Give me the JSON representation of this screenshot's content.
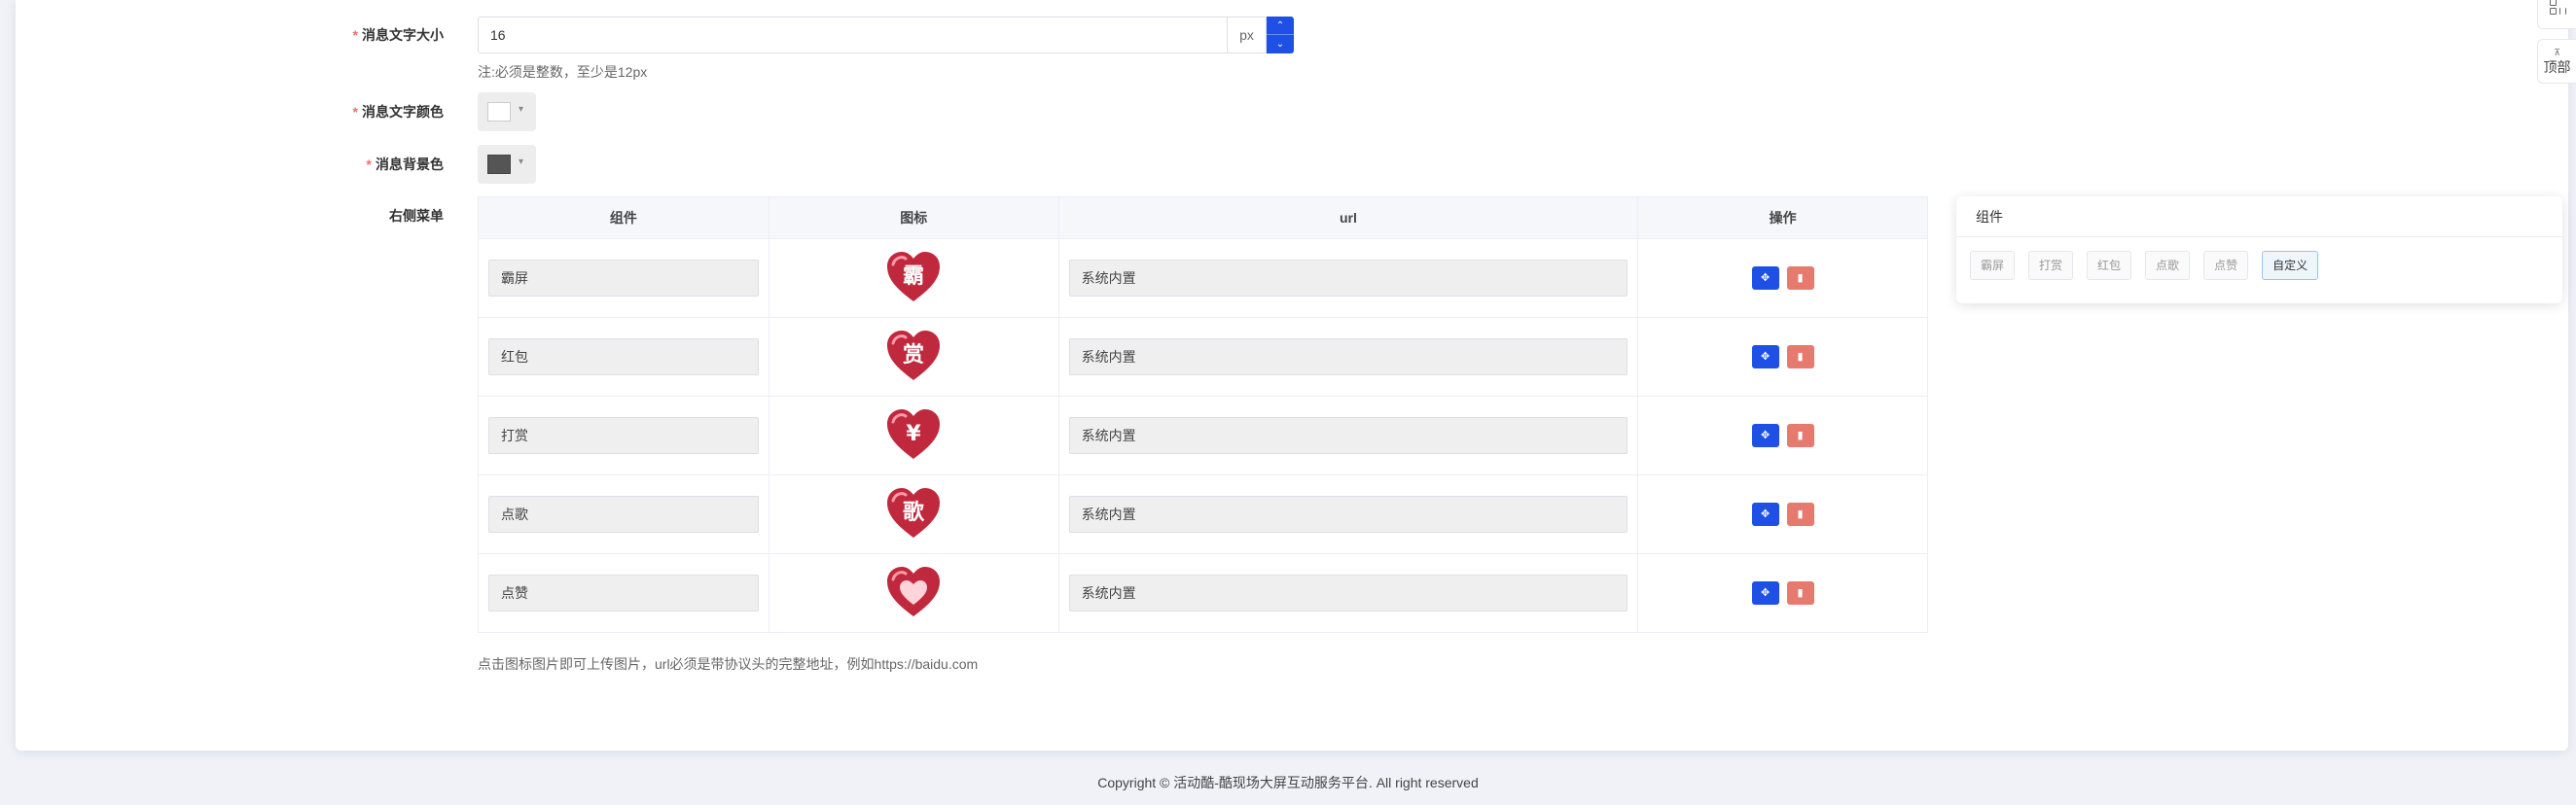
{
  "form": {
    "font_size": {
      "label": "消息文字大小",
      "required": "*",
      "value": "16",
      "unit": "px",
      "note": "注:必须是整数，至少是12px"
    },
    "font_color": {
      "label": "消息文字颜色",
      "required": "*",
      "color": "#ffffff"
    },
    "bg_color": {
      "label": "消息背景色",
      "required": "*",
      "color": "#555555"
    },
    "right_menu": {
      "label": "右侧菜单",
      "columns": [
        "组件",
        "图标",
        "url",
        "操作"
      ],
      "rows": [
        {
          "component": "霸屏",
          "icon_char": "霸",
          "url": "系统内置"
        },
        {
          "component": "红包",
          "icon_char": "赏",
          "url": "系统内置"
        },
        {
          "component": "打赏",
          "icon_char": "¥",
          "url": "系统内置"
        },
        {
          "component": "点歌",
          "icon_char": "歌",
          "url": "系统内置"
        },
        {
          "component": "点赞",
          "icon_char": "",
          "url": "系统内置"
        }
      ],
      "note": "点击图标图片即可上传图片，url必须是带协议头的完整地址，例如https://baidu.com"
    }
  },
  "side_panel": {
    "title": "组件",
    "tags": [
      "霸屏",
      "打赏",
      "红包",
      "点歌",
      "点赞",
      "自定义"
    ]
  },
  "floating": {
    "top_label": "顶部"
  },
  "footer": {
    "copyright": "Copyright © 活动酷-酷现场大屏互动服务平台. All right reserved"
  },
  "colors": {
    "primary": "#1e50e6",
    "danger": "#e67a6e",
    "heart": "#c0283d"
  }
}
